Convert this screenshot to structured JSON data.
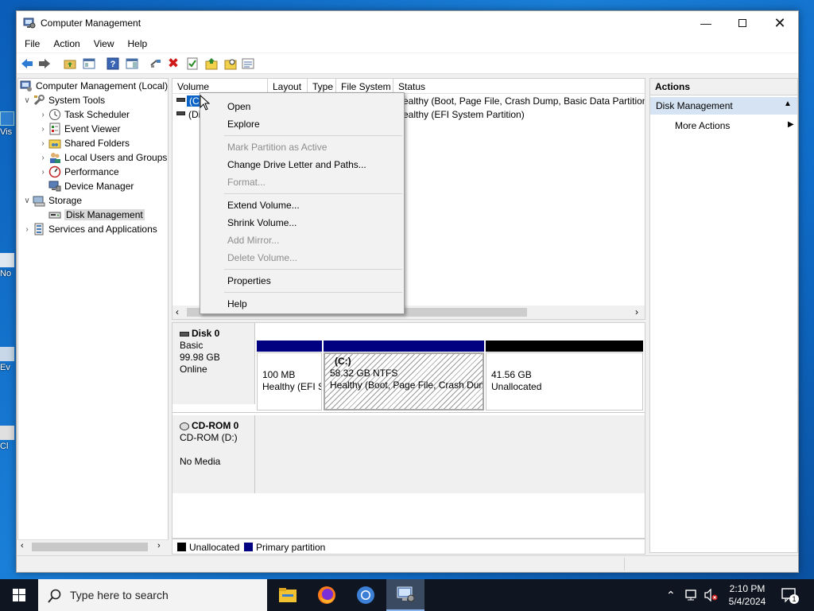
{
  "window": {
    "title": "Computer Management",
    "menu": [
      "File",
      "Action",
      "View",
      "Help"
    ]
  },
  "desktop_icons": [
    {
      "label": "Vis"
    },
    {
      "label": "No"
    },
    {
      "label": "Ev"
    },
    {
      "label": "Cl"
    }
  ],
  "tree": {
    "root": "Computer Management (Local)",
    "system_tools": "System Tools",
    "task_scheduler": "Task Scheduler",
    "event_viewer": "Event Viewer",
    "shared_folders": "Shared Folders",
    "local_users": "Local Users and Groups",
    "performance": "Performance",
    "device_manager": "Device Manager",
    "storage": "Storage",
    "disk_management": "Disk Management",
    "services": "Services and Applications"
  },
  "volume_list": {
    "columns": [
      "Volume",
      "Layout",
      "Type",
      "File System",
      "Status"
    ],
    "rows": [
      {
        "volume": "(C:)",
        "status": "Healthy (Boot, Page File, Crash Dump, Basic Data Partition)",
        "visible_status": "ealthy (Boot, Page File, Crash Dump, Basic Data Partition)",
        "visible_volume": "(C"
      },
      {
        "volume": "(Disk 0 partition 1)",
        "status": "Healthy (EFI System Partition)",
        "visible_status": "ealthy (EFI System Partition)",
        "visible_volume": "(Di"
      }
    ]
  },
  "disks": {
    "disk0": {
      "name": "Disk 0",
      "type": "Basic",
      "size": "99.98 GB",
      "state": "Online",
      "partitions": [
        {
          "title": "",
          "size": "100 MB",
          "status": "Healthy (EFI System Partition)",
          "visible_status": "Healthy (EFI S",
          "band_color": "#000080"
        },
        {
          "title": "(C:)",
          "size": "58.32 GB NTFS",
          "status": "Healthy (Boot, Page File, Crash Dump, Basic Data Partition)",
          "visible_status": "Healthy (Boot, Page File, Crash Dum",
          "band_color": "#000080"
        },
        {
          "title": "",
          "size": "41.56 GB",
          "status": "Unallocated",
          "visible_status": "Unallocated",
          "band_color": "#000000"
        }
      ]
    },
    "cdrom0": {
      "name": "CD-ROM 0",
      "drive": "CD-ROM (D:)",
      "media": "No Media"
    }
  },
  "legend": {
    "unallocated": "Unallocated",
    "primary": "Primary partition",
    "unallocated_color": "#000000",
    "primary_color": "#000080"
  },
  "actions": {
    "header": "Actions",
    "section": "Disk Management",
    "more": "More Actions"
  },
  "context_menu": {
    "open": "Open",
    "explore": "Explore",
    "mark_active": "Mark Partition as Active",
    "change_letter": "Change Drive Letter and Paths...",
    "format": "Format...",
    "extend": "Extend Volume...",
    "shrink": "Shrink Volume...",
    "add_mirror": "Add Mirror...",
    "delete": "Delete Volume...",
    "properties": "Properties",
    "help": "Help"
  },
  "taskbar": {
    "search_placeholder": "Type here to search",
    "time": "2:10 PM",
    "date": "5/4/2024",
    "notification_count": "1"
  }
}
